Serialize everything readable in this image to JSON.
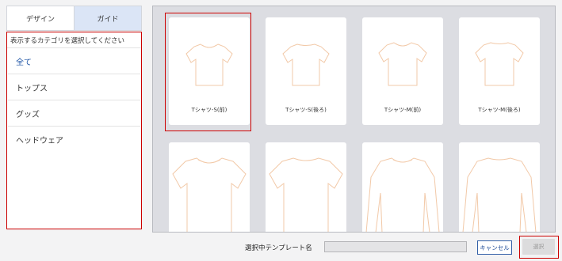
{
  "tabs": {
    "design": "デザイン",
    "guide": "ガイド"
  },
  "categories": {
    "header": "表示するカテゴリを選択してください",
    "items": [
      "全て",
      "トップス",
      "グッズ",
      "ヘッドウェア"
    ]
  },
  "templates": [
    {
      "label": "Tシャツ-S(前)",
      "icon": "tshirt-front-icon"
    },
    {
      "label": "Tシャツ-S(後ろ)",
      "icon": "tshirt-back-icon"
    },
    {
      "label": "Tシャツ-M(前)",
      "icon": "tshirt-front-icon"
    },
    {
      "label": "Tシャツ-M(後ろ)",
      "icon": "tshirt-back-icon"
    },
    {
      "label": "",
      "icon": "tshirt-icon"
    },
    {
      "label": "",
      "icon": "tshirt-icon"
    },
    {
      "label": "",
      "icon": "long-sleeve-icon"
    },
    {
      "label": "",
      "icon": "long-sleeve-icon"
    }
  ],
  "footer": {
    "selected_template_label": "選択中テンプレート名",
    "selected_template_value": "",
    "cancel_label": "キャンセル",
    "select_label": "選択"
  },
  "colors": {
    "accent": "#1f55a6",
    "outline": "#cc0000",
    "shirt_line": "#f2c9a8"
  }
}
